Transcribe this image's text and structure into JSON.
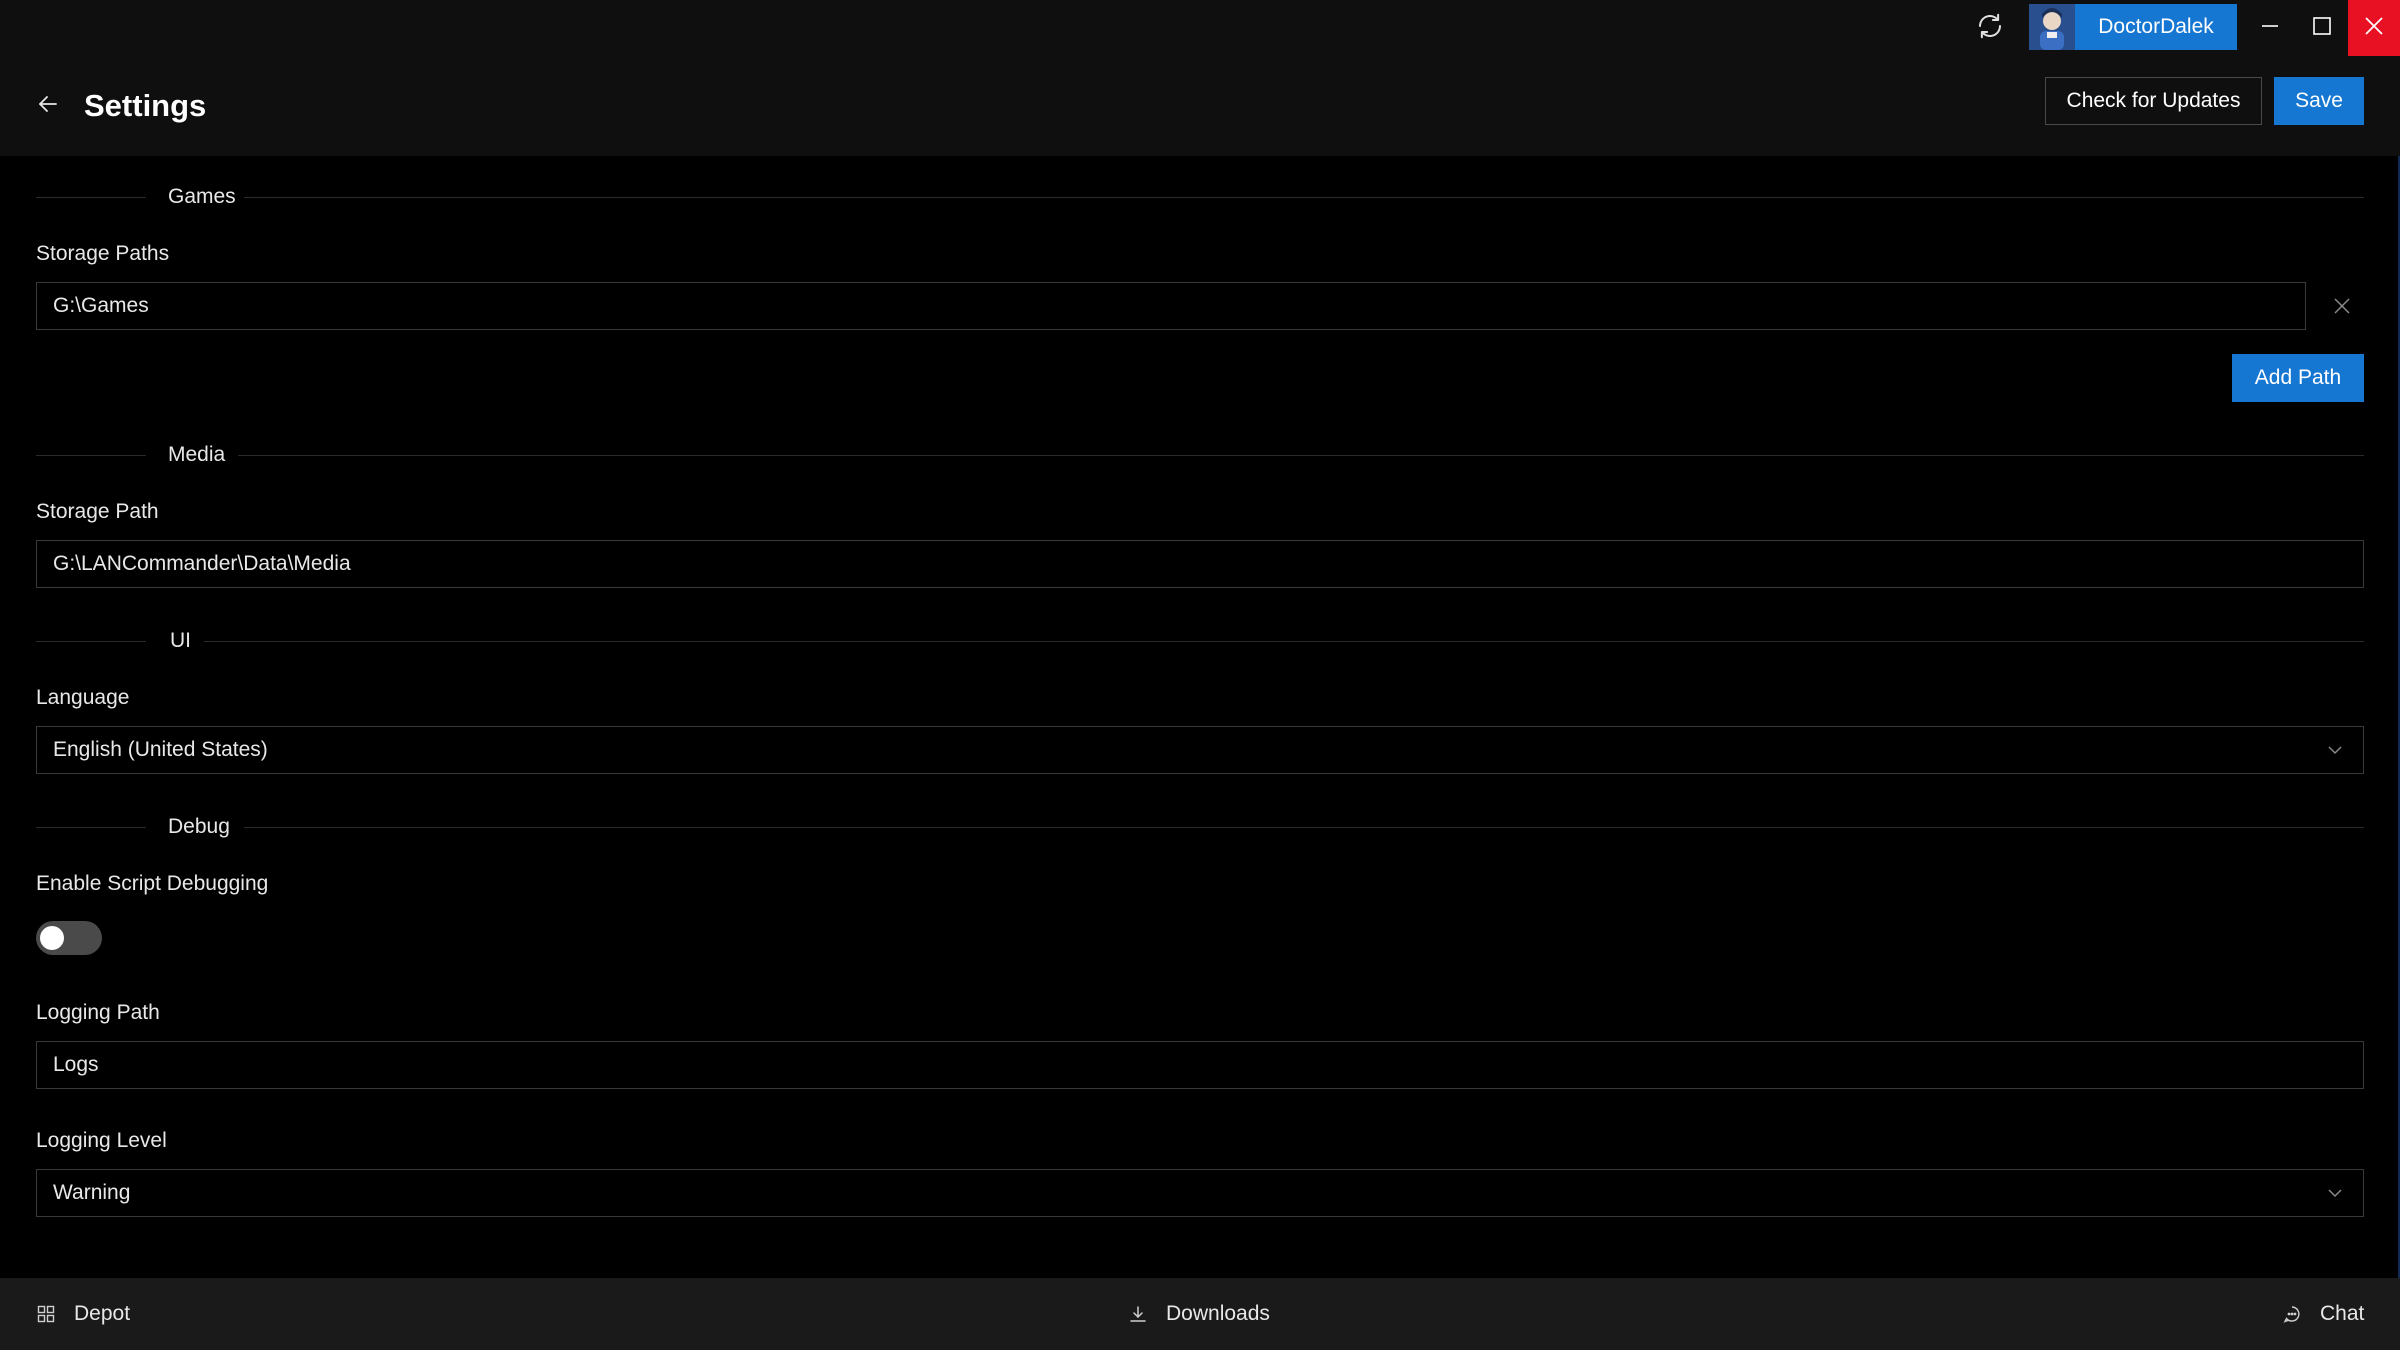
{
  "titlebar": {
    "username": "DoctorDalek",
    "icons": {
      "sync": "sync-icon",
      "minimize": "minimize-icon",
      "maximize": "maximize-icon",
      "close": "close-icon"
    },
    "close_color": "#e81123"
  },
  "header": {
    "title": "Settings",
    "check_updates_label": "Check for Updates",
    "save_label": "Save"
  },
  "sections": {
    "games": {
      "heading": "Games",
      "storage_paths_label": "Storage Paths",
      "paths": [
        "G:\\Games"
      ],
      "add_path_label": "Add Path"
    },
    "media": {
      "heading": "Media",
      "storage_path_label": "Storage Path",
      "storage_path": "G:\\LANCommander\\Data\\Media"
    },
    "ui": {
      "heading": "UI",
      "language_label": "Language",
      "language_value": "English (United States)"
    },
    "debug": {
      "heading": "Debug",
      "script_debugging_label": "Enable Script Debugging",
      "script_debugging_enabled": false,
      "logging_path_label": "Logging Path",
      "logging_path": "Logs",
      "logging_level_label": "Logging Level",
      "logging_level_value": "Warning"
    }
  },
  "footer": {
    "depot_label": "Depot",
    "downloads_label": "Downloads",
    "chat_label": "Chat"
  },
  "colors": {
    "accent": "#1677d2",
    "background": "#000000",
    "chrome": "#0f0f0f",
    "footer": "#1a1a1a"
  }
}
